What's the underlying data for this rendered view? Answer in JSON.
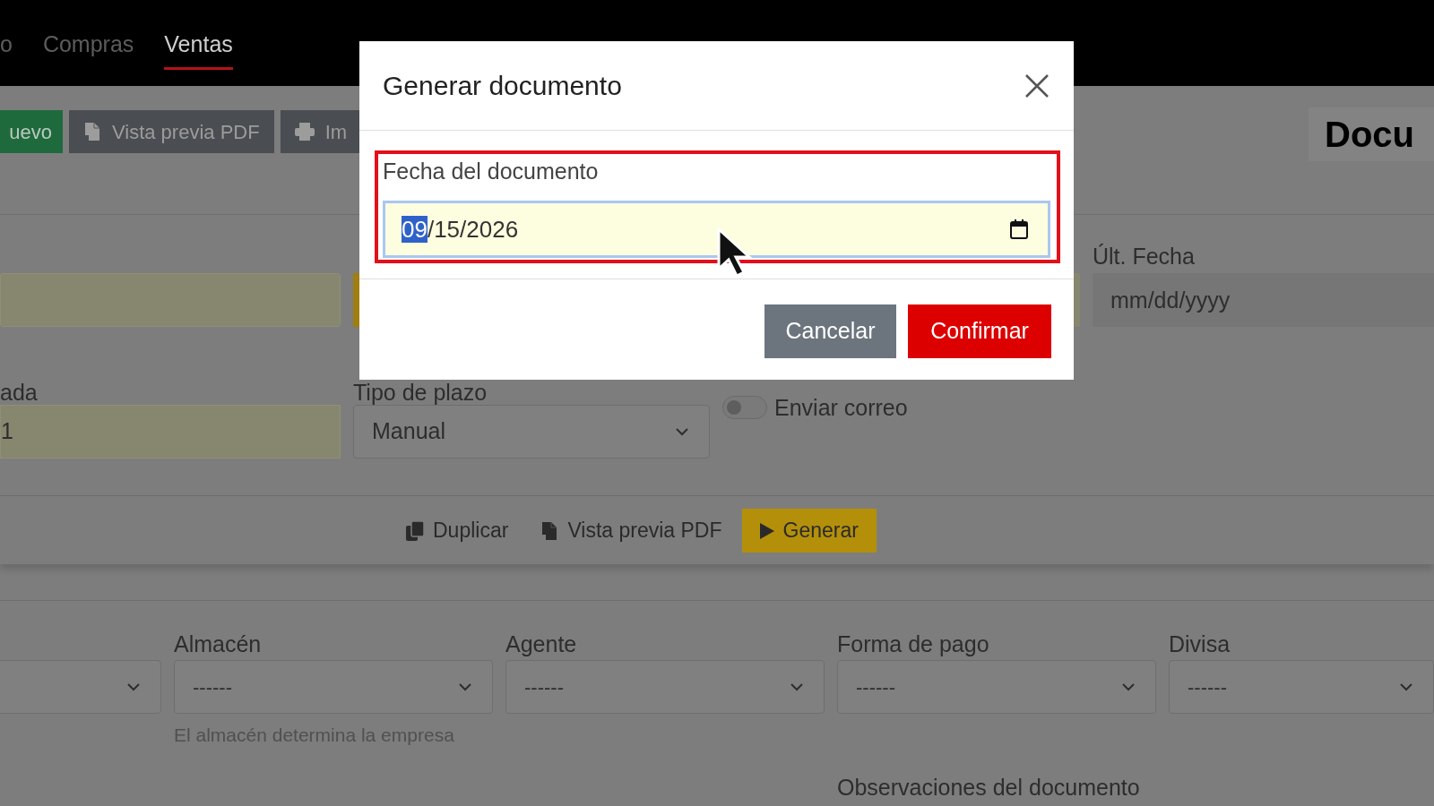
{
  "nav": {
    "tabs": [
      {
        "label": "o",
        "selected": false
      },
      {
        "label": "Compras",
        "selected": false
      },
      {
        "label": "Ventas",
        "selected": true
      }
    ]
  },
  "toolbar": {
    "buttons": [
      {
        "label": "uevo",
        "kind": "success"
      },
      {
        "label": "Vista previa PDF",
        "kind": "pdf"
      },
      {
        "label": "Im",
        "kind": "print"
      }
    ]
  },
  "page_title": "Docu",
  "form": {
    "ult_fecha": {
      "label": "Últ. Fecha",
      "placeholder": "mm/dd/yyyy"
    },
    "field_label": "ada",
    "field_value": "1",
    "tipo_plazo": {
      "label": "Tipo de plazo",
      "value": "Manual"
    },
    "enviar_correo": {
      "label": "Enviar correo",
      "on": false
    }
  },
  "actions": [
    {
      "label": "Duplicar",
      "kind": "duplicate"
    },
    {
      "label": "Vista previa PDF",
      "kind": "pdf"
    },
    {
      "label": "Generar",
      "kind": "primary"
    }
  ],
  "selects": [
    {
      "kind": "select"
    },
    {
      "kind": "select",
      "label": "Almacén",
      "value": "------",
      "help": "El almacén determina la empresa"
    },
    {
      "kind": "select",
      "label": "Agente",
      "value": "------"
    },
    {
      "kind": "select",
      "label": "Forma de pago",
      "value": "------"
    },
    {
      "kind": "select",
      "label": "Divisa",
      "value": "------"
    }
  ],
  "observaciones_label": "Observaciones del documento",
  "modal": {
    "title": "Generar documento",
    "field_label": "Fecha del documento",
    "value_parts": [
      {
        "text": "09",
        "selected": true
      },
      {
        "text": "/15/2026",
        "selected": false
      }
    ],
    "highlighted": true,
    "buttons": [
      {
        "label": "Cancelar",
        "kind": "secondary"
      },
      {
        "label": "Confirmar",
        "kind": "danger"
      }
    ]
  }
}
